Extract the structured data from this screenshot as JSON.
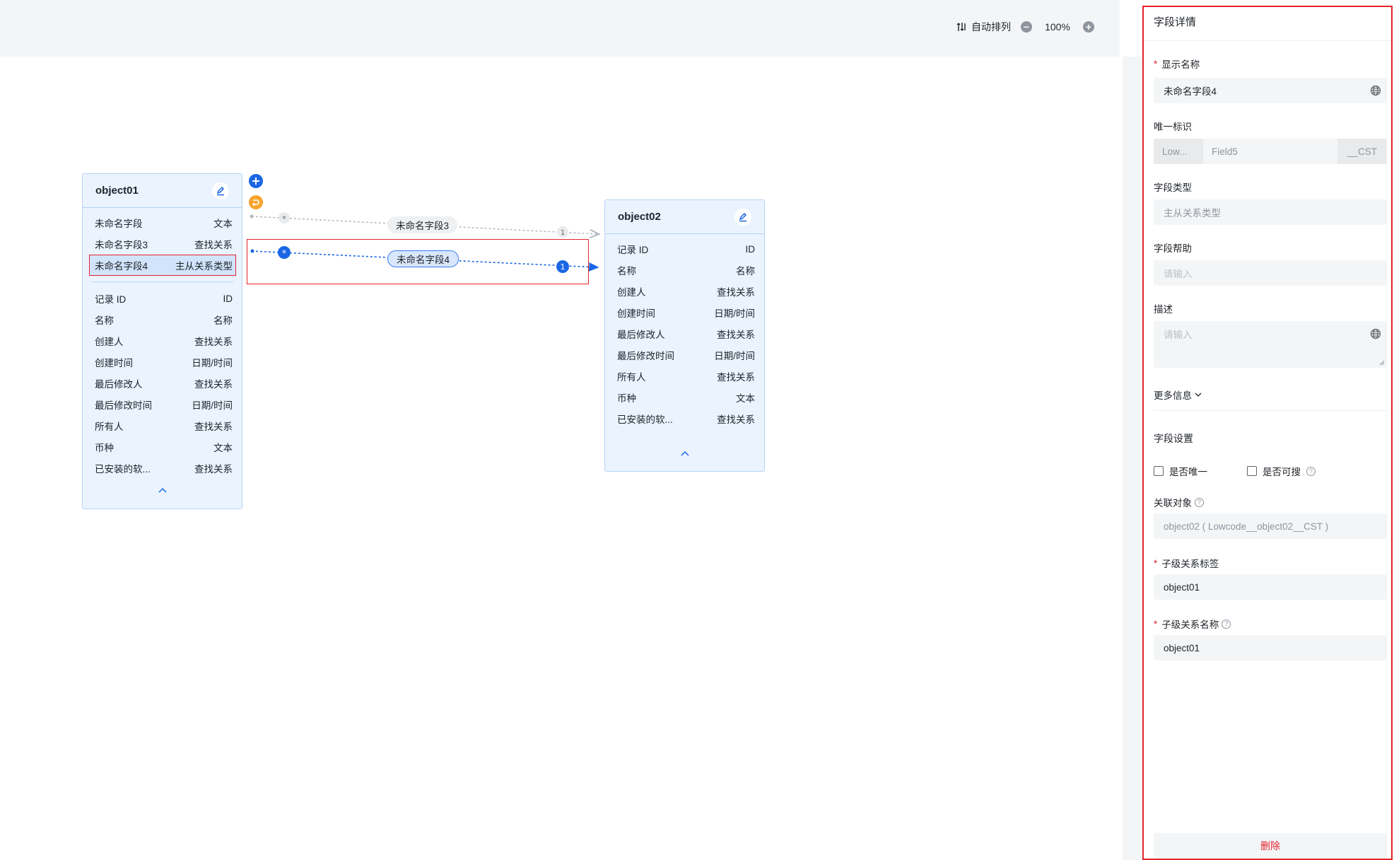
{
  "toolbar": {
    "auto_layout_label": "自动排列",
    "zoom_out_icon": "−",
    "zoom_level": "100%",
    "zoom_in_icon": "+"
  },
  "object01": {
    "title": "object01",
    "custom_fields": [
      {
        "name": "未命名字段",
        "type": "文本"
      },
      {
        "name": "未命名字段3",
        "type": "查找关系"
      },
      {
        "name": "未命名字段4",
        "type": "主从关系类型"
      }
    ],
    "system_fields": [
      {
        "name": "记录 ID",
        "type": "ID"
      },
      {
        "name": "名称",
        "type": "名称"
      },
      {
        "name": "创建人",
        "type": "查找关系"
      },
      {
        "name": "创建时间",
        "type": "日期/时间"
      },
      {
        "name": "最后修改人",
        "type": "查找关系"
      },
      {
        "name": "最后修改时间",
        "type": "日期/时间"
      },
      {
        "name": "所有人",
        "type": "查找关系"
      },
      {
        "name": "币种",
        "type": "文本"
      },
      {
        "name": "已安装的软...",
        "type": "查找关系"
      }
    ]
  },
  "object02": {
    "title": "object02",
    "system_fields": [
      {
        "name": "记录 ID",
        "type": "ID"
      },
      {
        "name": "名称",
        "type": "名称"
      },
      {
        "name": "创建人",
        "type": "查找关系"
      },
      {
        "name": "创建时间",
        "type": "日期/时间"
      },
      {
        "name": "最后修改人",
        "type": "查找关系"
      },
      {
        "name": "最后修改时间",
        "type": "日期/时间"
      },
      {
        "name": "所有人",
        "type": "查找关系"
      },
      {
        "name": "币种",
        "type": "文本"
      },
      {
        "name": "已安装的软...",
        "type": "查找关系"
      }
    ]
  },
  "relations": [
    {
      "label": "未命名字段3",
      "from_marker": "*",
      "to_marker": "1",
      "color": "#b4b8bf"
    },
    {
      "label": "未命名字段4",
      "from_marker": "*",
      "to_marker": "1",
      "color": "#1a66e5"
    }
  ],
  "panel": {
    "title": "字段详情",
    "display_name_label": "显示名称",
    "display_name_value": "未命名字段4",
    "unique_id_label": "唯一标识",
    "unique_id_prefix": "Low...",
    "unique_id_value": "Field5",
    "unique_id_suffix": "__CST",
    "field_type_label": "字段类型",
    "field_type_value": "主从关系类型",
    "field_help_label": "字段帮助",
    "field_help_placeholder": "请输入",
    "description_label": "描述",
    "description_placeholder": "请输入",
    "more_info_label": "更多信息",
    "field_settings_label": "字段设置",
    "unique_checkbox_label": "是否唯一",
    "searchable_checkbox_label": "是否可搜",
    "related_object_label": "关联对象",
    "related_object_value": "object02 ( Lowcode__object02__CST )",
    "child_label_label": "子级关系标签",
    "child_label_value": "object01",
    "child_name_label": "子级关系名称",
    "child_name_value": "object01",
    "delete_label": "删除"
  },
  "colors": {
    "accent": "#1a66e5",
    "danger": "#e3242b",
    "card_bg": "#eaf3fe",
    "orange": "#f7a52d"
  }
}
